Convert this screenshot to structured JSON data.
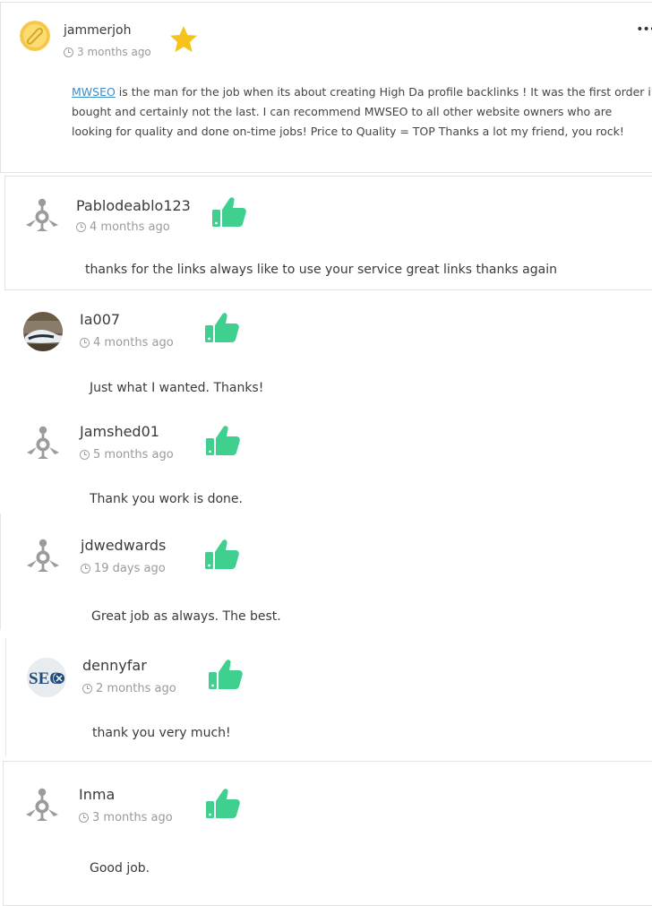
{
  "reviews": [
    {
      "username": "jammerjoh",
      "time": "3 months ago",
      "link_text": "MWSEO",
      "comment": " is the man for the job when its about creating High Da profile backlinks ! It was the first order i bought and certainly not the last. I can recommend MWSEO to all other website owners who are looking for quality and done on-time jobs! Price to Quality = TOP  Thanks a lot my friend, you rock!",
      "more_label": "•••"
    },
    {
      "username": "Pablodeablo123",
      "time": "4 months ago",
      "comment": "thanks for the links always like to use your service great links thanks again"
    },
    {
      "username": "Ia007",
      "time": "4 months ago",
      "comment": "Just what I wanted. Thanks!"
    },
    {
      "username": "Jamshed01",
      "time": "5 months ago",
      "comment": "Thank you work is done."
    },
    {
      "username": "jdwedwards",
      "time": "19 days ago",
      "comment": "Great job as always. The best."
    },
    {
      "username": "dennyfar",
      "time": "2 months ago",
      "comment": "thank you very much!",
      "avatar_text": "SEO"
    },
    {
      "username": "Inma",
      "time": "3 months ago",
      "comment": "Good job."
    }
  ],
  "colors": {
    "thumb": "#3fcf8e",
    "star": "#f7c31b",
    "link": "#3d8cc4",
    "avatar_default": "#9b9b9b"
  }
}
